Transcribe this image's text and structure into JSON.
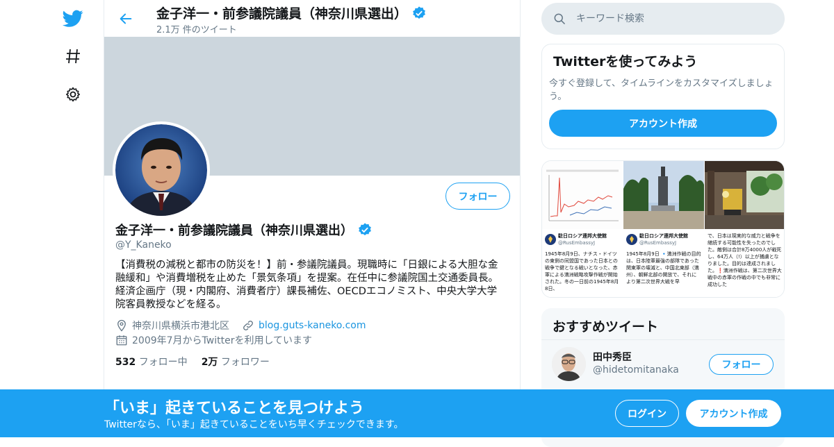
{
  "colors": {
    "accent": "#1da1f2",
    "banner": "#ccd6dd",
    "muted": "#657786"
  },
  "nav": {
    "items": [
      "twitter-logo-icon",
      "hashtag-icon",
      "settings-gear-icon"
    ]
  },
  "header": {
    "name": "金子洋一・前参議院議員（神奈川県選出）",
    "tweet_count": "2.1万 件のツイート"
  },
  "profile": {
    "name": "金子洋一・前参議院議員（神奈川県選出）",
    "handle": "@Y_Kaneko",
    "follow_label": "フォロー",
    "bio": "【消費税の減税と都市の防災を！】前・参議院議員。現職時に「日銀による大胆な金融緩和」や消費増税を止めた「景気条項」を提案。在任中に参議院国土交通委員長。経済企画庁（現・内閣府、消費者庁）課長補佐、OECDエコノミスト、中央大学大学院客員教授などを経る。",
    "location": "神奈川県横浜市港北区",
    "website": "blog.guts-kaneko.com",
    "joined": "2009年7月からTwitterを利用しています",
    "following_count": "532",
    "following_label": "フォロー中",
    "followers_count": "2万",
    "followers_label": "フォロワー"
  },
  "search": {
    "placeholder": "キーワード検索"
  },
  "signup_card": {
    "title": "Twitterを使ってみよう",
    "description": "今すぐ登録して、タイムラインをカスタマイズしましょう。",
    "button": "アカウント作成"
  },
  "media": {
    "tile4_title": "駐日ロシア連邦大使館",
    "tile4_handle": "@RusEmbassyJ",
    "tile4_text": "1945年8月9日、ナチス・ドイツの東側の同盟国であった日本との戦争で鍵となる戦いとなった、赤軍による満洲戦略攻撃作戦が開始された。冬の一日前の1945年8月8日、",
    "tile5_title": "駐日ロシア連邦大使館",
    "tile5_handle": "@RusEmbassyJ",
    "tile5_text": "1945年8月9日 🔹満洲作戦の目的は、日本陸軍最強の部隊であった関東軍の壊滅と、中国北東部（満州）、朝鮮北部の開放で、それにより第二次世界大戦を早",
    "tile6_text": "で、日本は現実的な威力と戦争を継続する可能性を失ったのでした。敵側は合計8万4000人が戦死し、64万人（!）以上が捕虜となりました。目的は達成されました。❗️満洲作戦は、第二次世界大戦中の赤軍の作戦の中でも非常に成功した"
  },
  "recommendations": {
    "title": "おすすめツイート",
    "user_name": "田中秀臣",
    "user_handle": "@hidetomitanaka",
    "follow_label": "フォロー"
  },
  "bottom_bar": {
    "title": "「いま」起きていることを見つけよう",
    "subtitle": "Twitterなら、「いま」起きていることをいち早くチェックできます。",
    "login": "ログイン",
    "signup": "アカウント作成"
  }
}
